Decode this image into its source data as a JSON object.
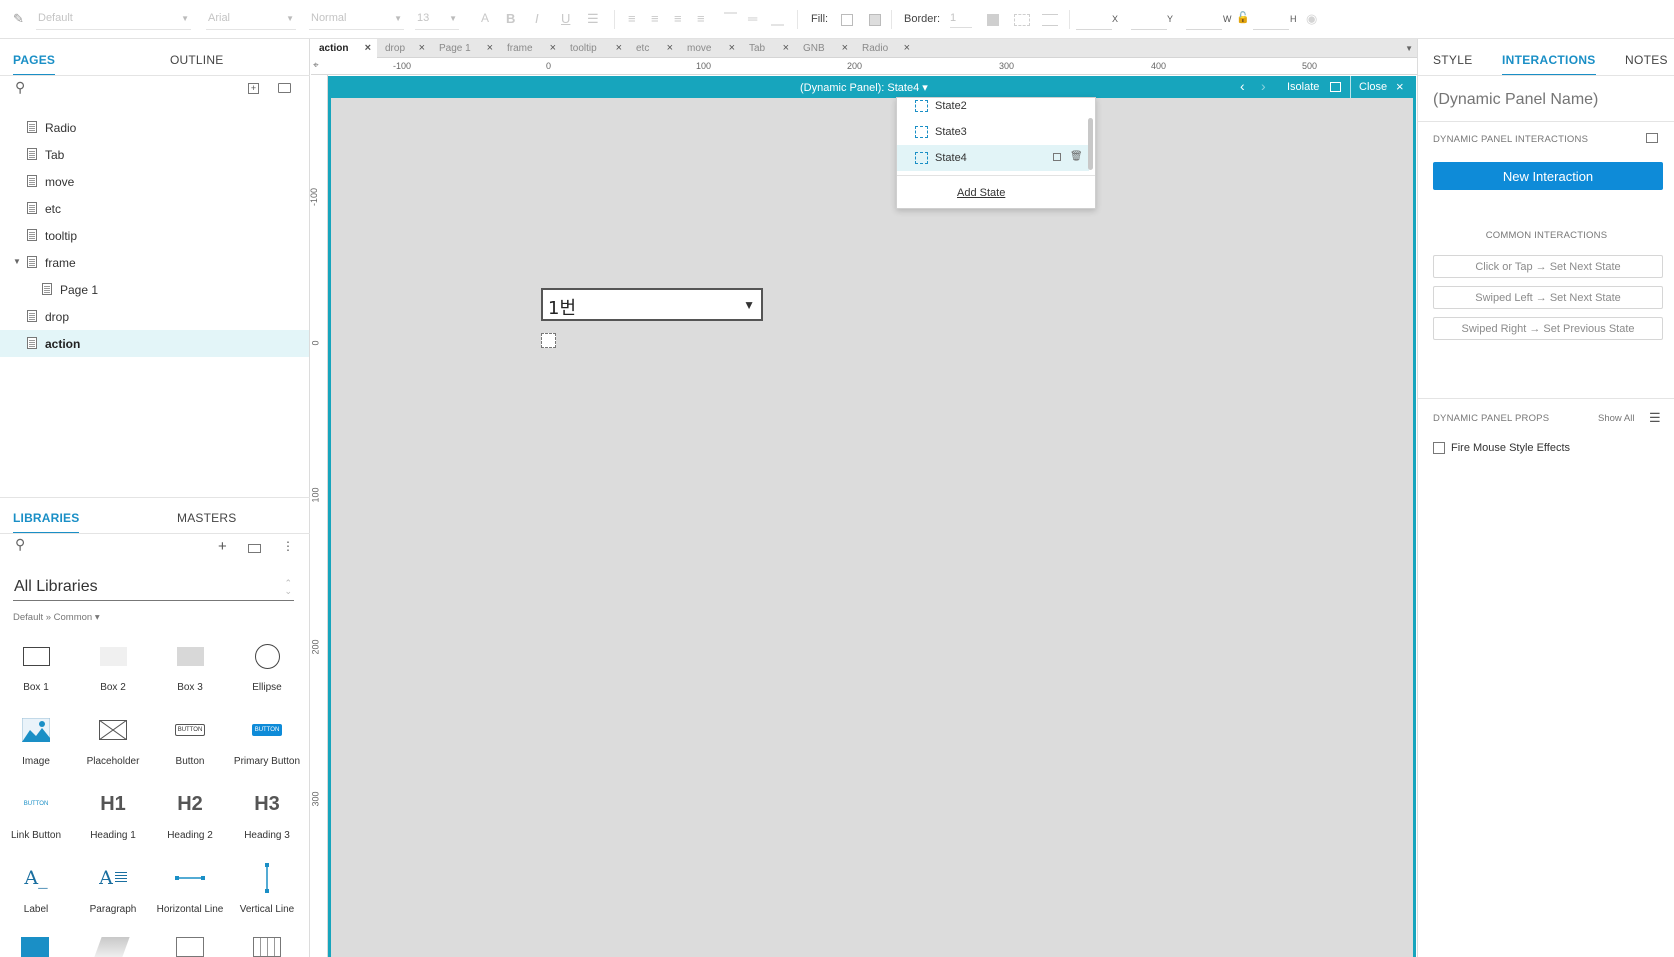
{
  "toolbar": {
    "style_dropdown": "Default",
    "font_dropdown": "Arial",
    "weight_dropdown": "Normal",
    "size_dropdown": "13",
    "fill_label": "Fill:",
    "border_label": "Border:",
    "border_value": "1",
    "x_label": "X",
    "y_label": "Y",
    "w_label": "W",
    "h_label": "H"
  },
  "left_panel": {
    "tabs": {
      "pages": "PAGES",
      "outline": "OUTLINE"
    },
    "pages": [
      {
        "label": "Radio",
        "indent": 0
      },
      {
        "label": "Tab",
        "indent": 0
      },
      {
        "label": "move",
        "indent": 0
      },
      {
        "label": "etc",
        "indent": 0
      },
      {
        "label": "tooltip",
        "indent": 0
      },
      {
        "label": "frame",
        "indent": 0,
        "expanded": true
      },
      {
        "label": "Page 1",
        "indent": 1
      },
      {
        "label": "drop",
        "indent": 0
      },
      {
        "label": "action",
        "indent": 0,
        "selected": true
      }
    ],
    "lib_tabs": {
      "libraries": "LIBRARIES",
      "masters": "MASTERS"
    },
    "library_select": "All Libraries",
    "breadcrumb": "Default » Common ▾",
    "widgets": [
      {
        "label": "Box 1",
        "icon": "box1"
      },
      {
        "label": "Box 2",
        "icon": "box2"
      },
      {
        "label": "Box 3",
        "icon": "box3"
      },
      {
        "label": "Ellipse",
        "icon": "ellipse"
      },
      {
        "label": "Image",
        "icon": "image"
      },
      {
        "label": "Placeholder",
        "icon": "placeholder"
      },
      {
        "label": "Button",
        "icon": "button",
        "glyph": "BUTTON"
      },
      {
        "label": "Primary Button",
        "icon": "primary-button",
        "glyph": "BUTTON"
      },
      {
        "label": "Link Button",
        "icon": "link-button",
        "glyph": "BUTTON"
      },
      {
        "label": "Heading 1",
        "icon": "h1",
        "glyph": "H1"
      },
      {
        "label": "Heading 2",
        "icon": "h2",
        "glyph": "H2"
      },
      {
        "label": "Heading 3",
        "icon": "h3",
        "glyph": "H3"
      },
      {
        "label": "Label",
        "icon": "label",
        "glyph": "A_"
      },
      {
        "label": "Paragraph",
        "icon": "paragraph",
        "glyph": "A"
      },
      {
        "label": "Horizontal Line",
        "icon": "hline"
      },
      {
        "label": "Vertical Line",
        "icon": "vline"
      }
    ]
  },
  "doc_tabs": [
    "action",
    "drop",
    "Page 1",
    "frame",
    "tooltip",
    "etc",
    "move",
    "Tab",
    "GNB",
    "Radio"
  ],
  "ruler": {
    "h_ticks": [
      "-100",
      "0",
      "100",
      "200",
      "300",
      "400",
      "500"
    ],
    "v_ticks": [
      "-100",
      "0",
      "100",
      "200",
      "300"
    ]
  },
  "dynamic_panel_bar": {
    "title": "(Dynamic Panel): State4 ▾",
    "isolate": "Isolate",
    "close": "Close"
  },
  "state_popup": {
    "states": [
      "State2",
      "State3",
      "State4"
    ],
    "selected": "State4",
    "add_state": "Add State"
  },
  "canvas": {
    "dropdown_value": "1번"
  },
  "right_panel": {
    "tabs": {
      "style": "STYLE",
      "interactions": "INTERACTIONS",
      "notes": "NOTES"
    },
    "name_placeholder": "(Dynamic Panel Name)",
    "interactions_title": "DYNAMIC PANEL INTERACTIONS",
    "new_interaction": "New Interaction",
    "common_title": "COMMON INTERACTIONS",
    "common": [
      "Click or Tap → Set Next State",
      "Swiped Left → Set Next State",
      "Swiped Right → Set Previous State"
    ],
    "props_title": "DYNAMIC PANEL PROPS",
    "show_all": "Show All",
    "fire_mouse": "Fire Mouse Style Effects"
  },
  "colors": {
    "accent": "#1a8fc6",
    "panel_teal": "#17a5bd",
    "primary_button": "#0e8bd8"
  }
}
